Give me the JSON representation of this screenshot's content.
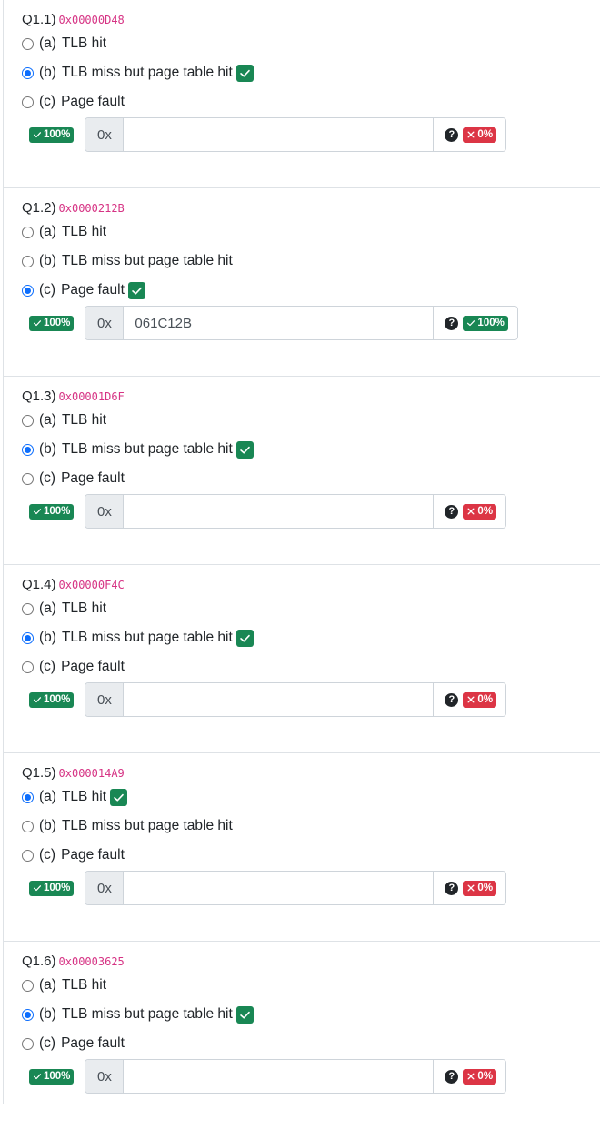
{
  "questions": [
    {
      "label": "Q1.1)",
      "address": "0x00000D48",
      "options": [
        {
          "letter": "(a)",
          "text": "TLB hit",
          "checked": false,
          "correct": false
        },
        {
          "letter": "(b)",
          "text": "TLB miss but page table hit",
          "checked": true,
          "correct": true
        },
        {
          "letter": "(c)",
          "text": "Page fault",
          "checked": false,
          "correct": false
        }
      ],
      "mc_score": "100%",
      "prefix": "0x",
      "value": "",
      "input_score": "0%",
      "input_ok": false
    },
    {
      "label": "Q1.2)",
      "address": "0x0000212B",
      "options": [
        {
          "letter": "(a)",
          "text": "TLB hit",
          "checked": false,
          "correct": false
        },
        {
          "letter": "(b)",
          "text": "TLB miss but page table hit",
          "checked": false,
          "correct": false
        },
        {
          "letter": "(c)",
          "text": "Page fault",
          "checked": true,
          "correct": true
        }
      ],
      "mc_score": "100%",
      "prefix": "0x",
      "value": "061C12B",
      "input_score": "100%",
      "input_ok": true
    },
    {
      "label": "Q1.3)",
      "address": "0x00001D6F",
      "options": [
        {
          "letter": "(a)",
          "text": "TLB hit",
          "checked": false,
          "correct": false
        },
        {
          "letter": "(b)",
          "text": "TLB miss but page table hit",
          "checked": true,
          "correct": true
        },
        {
          "letter": "(c)",
          "text": "Page fault",
          "checked": false,
          "correct": false
        }
      ],
      "mc_score": "100%",
      "prefix": "0x",
      "value": "",
      "input_score": "0%",
      "input_ok": false
    },
    {
      "label": "Q1.4)",
      "address": "0x00000F4C",
      "options": [
        {
          "letter": "(a)",
          "text": "TLB hit",
          "checked": false,
          "correct": false
        },
        {
          "letter": "(b)",
          "text": "TLB miss but page table hit",
          "checked": true,
          "correct": true
        },
        {
          "letter": "(c)",
          "text": "Page fault",
          "checked": false,
          "correct": false
        }
      ],
      "mc_score": "100%",
      "prefix": "0x",
      "value": "",
      "input_score": "0%",
      "input_ok": false
    },
    {
      "label": "Q1.5)",
      "address": "0x000014A9",
      "options": [
        {
          "letter": "(a)",
          "text": "TLB hit",
          "checked": true,
          "correct": true
        },
        {
          "letter": "(b)",
          "text": "TLB miss but page table hit",
          "checked": false,
          "correct": false
        },
        {
          "letter": "(c)",
          "text": "Page fault",
          "checked": false,
          "correct": false
        }
      ],
      "mc_score": "100%",
      "prefix": "0x",
      "value": "",
      "input_score": "0%",
      "input_ok": false
    },
    {
      "label": "Q1.6)",
      "address": "0x00003625",
      "options": [
        {
          "letter": "(a)",
          "text": "TLB hit",
          "checked": false,
          "correct": false
        },
        {
          "letter": "(b)",
          "text": "TLB miss but page table hit",
          "checked": true,
          "correct": true
        },
        {
          "letter": "(c)",
          "text": "Page fault",
          "checked": false,
          "correct": false
        }
      ],
      "mc_score": "100%",
      "prefix": "0x",
      "value": "",
      "input_score": "0%",
      "input_ok": false
    }
  ],
  "colors": {
    "success": "#198754",
    "danger": "#dc3545",
    "radio_checked": "#0d6efd",
    "address": "#d63384"
  },
  "icons": {
    "check": "check-icon",
    "cross": "x-icon",
    "help": "question-circle-icon"
  }
}
